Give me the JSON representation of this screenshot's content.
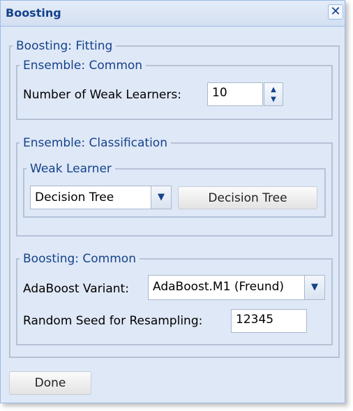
{
  "dialog": {
    "title": "Boosting",
    "close_icon": "close-icon"
  },
  "fitting": {
    "legend": "Boosting: Fitting",
    "ensemble_common": {
      "legend": "Ensemble: Common",
      "weak_learners_label": "Number of Weak Learners:",
      "weak_learners_value": "10"
    },
    "ensemble_classification": {
      "legend": "Ensemble: Classification",
      "weak_learner": {
        "legend": "Weak Learner",
        "selected": "Decision Tree",
        "button_label": "Decision Tree"
      }
    },
    "boosting_common": {
      "legend": "Boosting: Common",
      "variant_label": "AdaBoost Variant:",
      "variant_value": "AdaBoost.M1 (Freund)",
      "seed_label": "Random Seed for Resampling:",
      "seed_value": "12345"
    }
  },
  "footer": {
    "done_label": "Done"
  },
  "colors": {
    "accent": "#15428b",
    "panel_bg": "#dfe8f6",
    "border": "#99bbe8"
  }
}
